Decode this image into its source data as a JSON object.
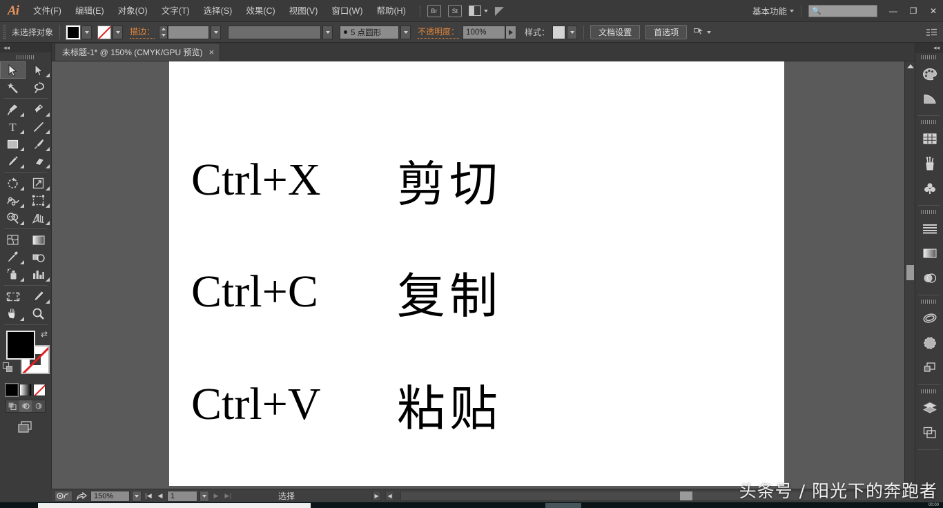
{
  "app": {
    "logo": "Ai",
    "workspace_label": "基本功能",
    "search_placeholder": ""
  },
  "menubar": {
    "items": [
      {
        "label": "文件(F)",
        "name": "menu-file"
      },
      {
        "label": "编辑(E)",
        "name": "menu-edit"
      },
      {
        "label": "对象(O)",
        "name": "menu-object"
      },
      {
        "label": "文字(T)",
        "name": "menu-type"
      },
      {
        "label": "选择(S)",
        "name": "menu-select"
      },
      {
        "label": "效果(C)",
        "name": "menu-effect"
      },
      {
        "label": "视图(V)",
        "name": "menu-view"
      },
      {
        "label": "窗口(W)",
        "name": "menu-window"
      },
      {
        "label": "帮助(H)",
        "name": "menu-help"
      }
    ],
    "bridge_label": "Br",
    "stock_label": "St",
    "window_buttons": {
      "minimize": "—",
      "restore": "❐",
      "close": "✕"
    }
  },
  "controlbar": {
    "selection_status": "未选择对象",
    "stroke_label": "描边：",
    "stroke_weight": "",
    "stroke_profile": "",
    "brush_label": "5 点圆形",
    "opacity_label": "不透明度：",
    "opacity_value": "100%",
    "style_label": "样式：",
    "document_setup_label": "文档设置",
    "preferences_label": "首选项"
  },
  "tabbar": {
    "tabs": [
      {
        "title": "未标题-1* @ 150% (CMYK/GPU 预览)",
        "close": "×"
      }
    ]
  },
  "toolbar": {
    "collapse": "◂◂",
    "tools": [
      {
        "name": "selection-tool",
        "icon": "arrow-solid",
        "active": true,
        "flyout": false
      },
      {
        "name": "direct-selection-tool",
        "icon": "arrow-hollow",
        "active": false,
        "flyout": true
      },
      {
        "name": "magic-wand-tool",
        "icon": "magic-wand",
        "active": false,
        "flyout": false
      },
      {
        "name": "lasso-tool",
        "icon": "lasso",
        "active": false,
        "flyout": false
      },
      {
        "name": "pen-tool",
        "icon": "pen",
        "active": false,
        "flyout": true
      },
      {
        "name": "curvature-tool",
        "icon": "curvature",
        "active": false,
        "flyout": true
      },
      {
        "name": "type-tool",
        "icon": "type-T",
        "active": false,
        "flyout": true
      },
      {
        "name": "line-segment-tool",
        "icon": "line",
        "active": false,
        "flyout": true
      },
      {
        "name": "rectangle-tool",
        "icon": "rectangle",
        "active": false,
        "flyout": true
      },
      {
        "name": "paintbrush-tool",
        "icon": "paintbrush",
        "active": false,
        "flyout": true
      },
      {
        "name": "pencil-tool",
        "icon": "pencil",
        "active": false,
        "flyout": true
      },
      {
        "name": "eraser-tool",
        "icon": "eraser",
        "active": false,
        "flyout": true
      },
      {
        "name": "rotate-tool",
        "icon": "rotate",
        "active": false,
        "flyout": true
      },
      {
        "name": "scale-tool",
        "icon": "scale",
        "active": false,
        "flyout": true
      },
      {
        "name": "width-tool",
        "icon": "width",
        "active": false,
        "flyout": true
      },
      {
        "name": "free-transform-tool",
        "icon": "free-transform",
        "active": false,
        "flyout": true
      },
      {
        "name": "shape-builder-tool",
        "icon": "shape-builder",
        "active": false,
        "flyout": true
      },
      {
        "name": "perspective-grid-tool",
        "icon": "perspective-grid",
        "active": false,
        "flyout": true
      },
      {
        "name": "mesh-tool",
        "icon": "mesh",
        "active": false,
        "flyout": false
      },
      {
        "name": "gradient-tool",
        "icon": "gradient",
        "active": false,
        "flyout": false
      },
      {
        "name": "eyedropper-tool",
        "icon": "eyedropper",
        "active": false,
        "flyout": true
      },
      {
        "name": "blend-tool",
        "icon": "blend",
        "active": false,
        "flyout": false
      },
      {
        "name": "symbol-sprayer-tool",
        "icon": "symbol-sprayer",
        "active": false,
        "flyout": true
      },
      {
        "name": "column-graph-tool",
        "icon": "bar-graph",
        "active": false,
        "flyout": true
      },
      {
        "name": "artboard-tool",
        "icon": "artboard",
        "active": false,
        "flyout": false
      },
      {
        "name": "slice-tool",
        "icon": "slice",
        "active": false,
        "flyout": true
      },
      {
        "name": "hand-tool",
        "icon": "hand",
        "active": false,
        "flyout": true
      },
      {
        "name": "zoom-tool",
        "icon": "magnifier",
        "active": false,
        "flyout": false
      }
    ],
    "fill_color": "#000000",
    "stroke_color": "#ffffff",
    "stroke_is_none": true,
    "color_modes": [
      "color",
      "gradient",
      "none"
    ],
    "draw_modes": [
      "draw-normal",
      "draw-behind",
      "draw-inside"
    ],
    "screen_mode": "screen-mode"
  },
  "rightdock": {
    "collapse": "◂◂",
    "groups": [
      {
        "items": [
          {
            "name": "panel-color",
            "icon": "palette-icon"
          },
          {
            "name": "panel-color-guide",
            "icon": "color-guide-icon"
          }
        ]
      },
      {
        "items": [
          {
            "name": "panel-swatches",
            "icon": "swatches-grid-icon"
          },
          {
            "name": "panel-brushes",
            "icon": "brushes-cup-icon"
          },
          {
            "name": "panel-symbols",
            "icon": "clover-icon"
          }
        ]
      },
      {
        "items": [
          {
            "name": "panel-stroke",
            "icon": "stroke-lines-icon"
          },
          {
            "name": "panel-gradient",
            "icon": "gradient-square-icon"
          },
          {
            "name": "panel-transparency",
            "icon": "transparency-circles-icon"
          }
        ]
      },
      {
        "items": [
          {
            "name": "panel-appearance",
            "icon": "appearance-loop-icon"
          },
          {
            "name": "panel-graphic-styles",
            "icon": "graphic-styles-circle-icon"
          },
          {
            "name": "panel-transform",
            "icon": "transform-squares-icon"
          }
        ]
      },
      {
        "items": [
          {
            "name": "panel-layers",
            "icon": "layers-stack-icon"
          },
          {
            "name": "panel-artboards",
            "icon": "artboards-icon"
          }
        ]
      }
    ]
  },
  "canvas": {
    "artboard_background": "#ffffff",
    "canvas_background": "#5a5a5a",
    "rows": [
      {
        "shortcut": "Ctrl+X",
        "meaning": "剪切"
      },
      {
        "shortcut": "Ctrl+C",
        "meaning": "复制"
      },
      {
        "shortcut": "Ctrl+V",
        "meaning": "粘贴"
      }
    ]
  },
  "statusbar": {
    "zoom_value": "150%",
    "artboard_value": "1",
    "status_text": "选择",
    "first_label": "|◀",
    "prev_label": "◀",
    "next_label": "▶",
    "last_label": "▶|"
  },
  "watermark": {
    "text": "头条号 / 阳光下的奔跑者"
  },
  "taskbar": {
    "clock": "00:00"
  }
}
